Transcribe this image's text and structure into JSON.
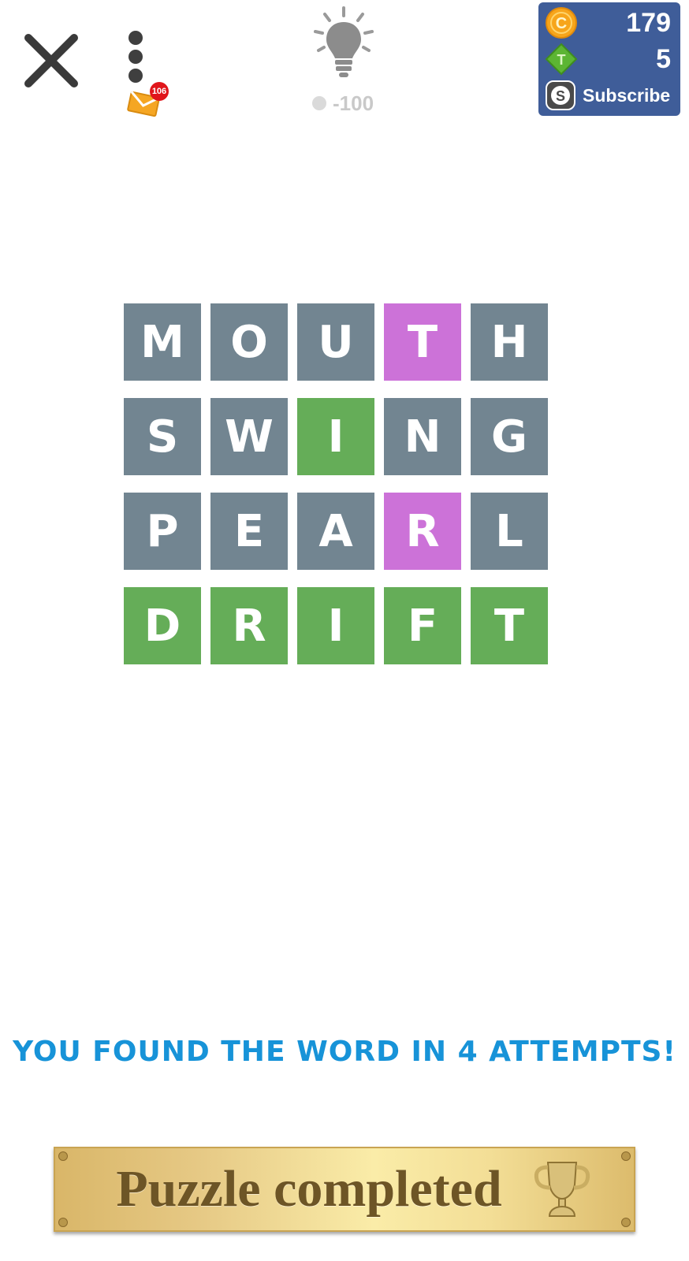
{
  "toolbar": {
    "mail_badge": "106",
    "hint_cost": "-100"
  },
  "currency": {
    "coins": "179",
    "tokens": "5",
    "subscribe_label": "Subscribe",
    "coin_letter": "C",
    "token_letter": "T",
    "subscribe_letter": "S"
  },
  "board": {
    "rows": [
      {
        "word": "MOUTH",
        "letters": [
          "M",
          "O",
          "U",
          "T",
          "H"
        ],
        "states": [
          "absent",
          "absent",
          "absent",
          "present",
          "absent"
        ]
      },
      {
        "word": "SWING",
        "letters": [
          "S",
          "W",
          "I",
          "N",
          "G"
        ],
        "states": [
          "absent",
          "absent",
          "correct",
          "absent",
          "absent"
        ]
      },
      {
        "word": "PEARL",
        "letters": [
          "P",
          "E",
          "A",
          "R",
          "L"
        ],
        "states": [
          "absent",
          "absent",
          "absent",
          "present",
          "absent"
        ]
      },
      {
        "word": "DRIFT",
        "letters": [
          "D",
          "R",
          "I",
          "F",
          "T"
        ],
        "states": [
          "correct",
          "correct",
          "correct",
          "correct",
          "correct"
        ]
      }
    ]
  },
  "result": {
    "message": "YOU FOUND THE WORD IN 4 ATTEMPTS!"
  },
  "plaque": {
    "label": "Puzzle completed"
  },
  "colors": {
    "absent": "#728591",
    "present": "#cc72d8",
    "correct": "#65ad58",
    "message": "#1793d8",
    "currency_panel": "#3f5d99"
  },
  "icons": [
    "close-icon",
    "more-vert-icon",
    "mail-icon",
    "lightbulb-icon",
    "coin-icon",
    "token-icon",
    "subscribe-icon",
    "trophy-icon"
  ]
}
